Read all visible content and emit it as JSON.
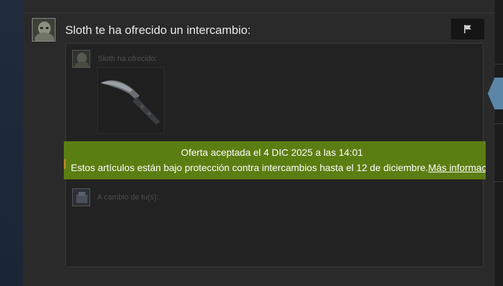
{
  "trade": {
    "title": "Sloth te ha ofrecido un intercambio:",
    "their_offer_label": "Sloth ha ofrecido:",
    "your_items_label": "A cambio de tu(s):"
  },
  "banner": {
    "line1": "Oferta aceptada el 4 DIC 2025 a las 14:01",
    "line2": "Estos artículos están bajo protección contra intercambios hasta el 12 de diciembre.",
    "link": "Más informac"
  },
  "colors": {
    "banner_green": "#5b7e12",
    "panel_bg": "#2a2a2a",
    "text_dim": "#4f4f4f"
  },
  "icons": {
    "flag": "flag-icon",
    "item": "knife-icon",
    "nav": "chevron-left-icon"
  }
}
